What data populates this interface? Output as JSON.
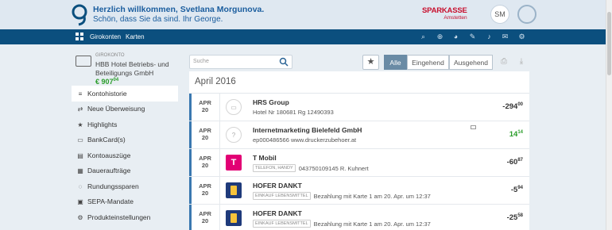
{
  "header": {
    "greeting": "Herzlich willkommen, Svetlana Morgunova.",
    "subgreeting": "Schön, dass Sie da sind. Ihr George.",
    "brand_name": "SPARKASSE",
    "brand_sub": "Amstetten",
    "avatar": "SM"
  },
  "nav": {
    "tabs": [
      "Girokonten",
      "Karten"
    ],
    "icons": [
      "search-icon",
      "add-icon",
      "chart-icon",
      "edit-icon",
      "bell-icon",
      "message-icon",
      "settings-icon"
    ]
  },
  "account": {
    "type_label": "GIROKONTO",
    "name": "HBB Hotel Betriebs- und Beteiligungs GmbH",
    "balance_main": "€ 907",
    "balance_cents": "04"
  },
  "sidebar": {
    "items": [
      {
        "label": "Kontohistorie",
        "icon": "list-icon"
      },
      {
        "label": "Neue Überweisung",
        "icon": "transfer-icon"
      },
      {
        "label": "Highlights",
        "icon": "star-icon"
      },
      {
        "label": "BankCard(s)",
        "icon": "card-icon"
      },
      {
        "label": "Kontoauszüge",
        "icon": "statement-icon"
      },
      {
        "label": "Daueraufträge",
        "icon": "standing-order-icon"
      },
      {
        "label": "Rundungssparen",
        "icon": "savings-icon"
      },
      {
        "label": "SEPA-Mandate",
        "icon": "sepa-icon"
      },
      {
        "label": "Produkteinstellungen",
        "icon": "gear-icon"
      }
    ]
  },
  "toolbar": {
    "search_placeholder": "Suche",
    "filters": [
      "Alle",
      "Eingehend",
      "Ausgehend"
    ],
    "active_filter": "Alle"
  },
  "month": "April 2016",
  "transactions": [
    {
      "month": "APR",
      "day": "20",
      "name": "HRS Group",
      "tag": "",
      "detail": "Hotel Nr 180681 Rg 12490393",
      "amount": "-294",
      "cents": "00",
      "icon": "card-logo-icon"
    },
    {
      "month": "APR",
      "day": "20",
      "name": "Internetmarketing Bielefeld GmbH",
      "tag": "",
      "detail": "ep000486566 www.druckerzubehoer.at",
      "amount": "14",
      "cents": "14",
      "icon": "unknown-merchant-icon"
    },
    {
      "month": "APR",
      "day": "20",
      "name": "T Mobil",
      "tag": "TELEFON, HANDY",
      "detail": "043750109145 R. Kuhnert",
      "amount": "-60",
      "cents": "87",
      "icon": "telekom-logo-icon"
    },
    {
      "month": "APR",
      "day": "20",
      "name": "HOFER DANKT",
      "tag": "EINKAUF LEBENSMITTEL",
      "detail": "Bezahlung mit Karte 1 am 20. Apr. um 12:37",
      "amount": "-5",
      "cents": "94",
      "icon": "hofer-logo-icon"
    },
    {
      "month": "APR",
      "day": "20",
      "name": "HOFER DANKT",
      "tag": "EINKAUF LEBENSMITTEL",
      "detail": "Bezahlung mit Karte 1 am 20. Apr. um 12:37",
      "amount": "-25",
      "cents": "58",
      "icon": "hofer-logo-icon"
    }
  ]
}
